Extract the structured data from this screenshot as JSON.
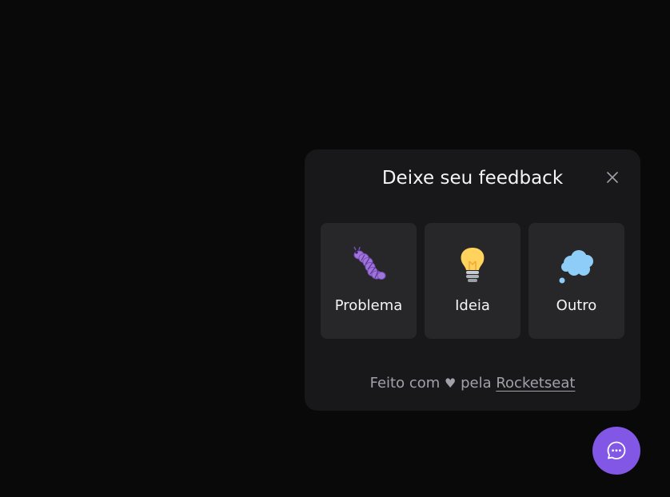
{
  "widget": {
    "title": "Deixe seu feedback",
    "close_icon": "close-icon",
    "types": [
      {
        "label": "Problema",
        "icon": "bug-icon"
      },
      {
        "label": "Ideia",
        "icon": "lightbulb-icon"
      },
      {
        "label": "Outro",
        "icon": "thought-bubble-icon"
      }
    ],
    "footer": {
      "prefix": "Feito com",
      "heart": "♥",
      "middle": "pela",
      "link": "Rocketseat"
    }
  },
  "fab": {
    "icon": "chat-icon",
    "color": "#8257e5"
  },
  "colors": {
    "background": "#09090a",
    "panel": "#18181b",
    "card": "#27272a",
    "text": "#f4f4f5",
    "muted": "#a1a1aa",
    "brand": "#8257e5"
  }
}
